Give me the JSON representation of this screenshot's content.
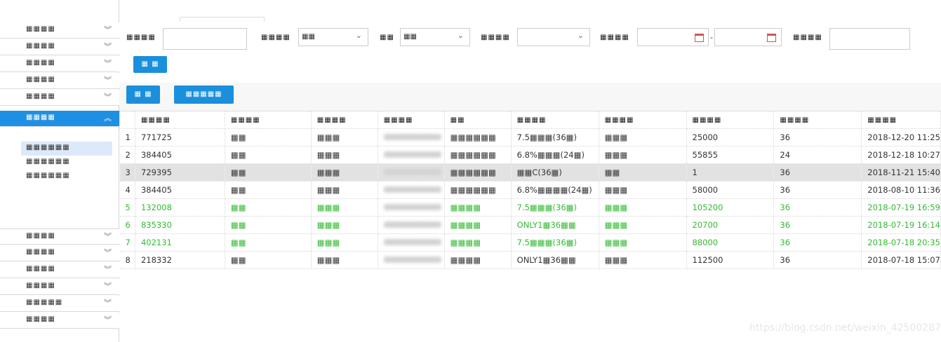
{
  "sidebar": {
    "top_items": [
      {
        "label": "▦▦▦▦"
      },
      {
        "label": "▦▦▦▦"
      },
      {
        "label": "▦▦▦▦"
      },
      {
        "label": "▦▦▦▦"
      },
      {
        "label": "▦▦▦▦"
      },
      {
        "label": "▦▦▦▦"
      }
    ],
    "sub_items": [
      {
        "label": "▦▦▦▦▦▦"
      },
      {
        "label": "▦▦▦▦▦▦"
      },
      {
        "label": "▦▦▦▦▦▦"
      }
    ],
    "bottom_items": [
      {
        "label": "▦▦▦▦"
      },
      {
        "label": "▦▦▦▦"
      },
      {
        "label": "▦▦▦▦"
      },
      {
        "label": "▦▦▦▦"
      },
      {
        "label": "▦▦▦▦▦"
      },
      {
        "label": "▦▦▦▦"
      }
    ]
  },
  "filters": {
    "f1_label": "▦▦▦▦",
    "f2_label": "▦▦▦▦",
    "f2_value": "▦▦",
    "f3_label": "▦▦",
    "f3_value": "▦▦",
    "f4_label": "▦▦▦▦",
    "f5_label": "▦▦▦▦",
    "date_sep": "-",
    "f6_label": "▦▦▦▦",
    "search_btn": "▦ ▦"
  },
  "toolbar": {
    "btn1": "▦ ▦",
    "btn2": "▦▦▦▦▦"
  },
  "table": {
    "headers": [
      "▦▦▦▦",
      "▦▦▦▦",
      "▦▦▦▦",
      "▦▦▦▦",
      "▦▦",
      "▦▦▦▦",
      "▦▦▦▦",
      "▦▦▦▦",
      "▦▦▦▦",
      "▦▦▦▦"
    ],
    "rows": [
      {
        "idx": "1",
        "c1": "771725",
        "c2": "▦▦",
        "c3": "▦▦▦",
        "c5": "▦▦▦▦▦▦",
        "c6": "7.5▦▦▦(36▦)",
        "c7": "▦▦▦",
        "c8": "25000",
        "c9": "36",
        "c10": "2018-12-20 11:25",
        "style": ""
      },
      {
        "idx": "2",
        "c1": "384405",
        "c2": "▦▦",
        "c3": "▦▦▦",
        "c5": "▦▦▦▦▦▦",
        "c6": "6.8%▦▦▦(24▦)",
        "c7": "▦▦▦",
        "c8": "55855",
        "c9": "24",
        "c10": "2018-12-18 10:27",
        "style": ""
      },
      {
        "idx": "3",
        "c1": "729395",
        "c2": "▦▦",
        "c3": "▦▦▦",
        "c5": "▦▦▦▦▦▦",
        "c6": "▦▦C(36▦)",
        "c7": "▦▦",
        "c8": "1",
        "c9": "36",
        "c10": "2018-11-21 15:40",
        "style": "gray"
      },
      {
        "idx": "4",
        "c1": "384405",
        "c2": "▦▦",
        "c3": "▦▦▦",
        "c5": "▦▦▦▦▦▦",
        "c6": "6.8%▦▦▦▦(24▦)",
        "c7": "▦▦▦",
        "c8": "58000",
        "c9": "36",
        "c10": "2018-08-10 11:36",
        "style": ""
      },
      {
        "idx": "5",
        "c1": "132008",
        "c2": "▦▦",
        "c3": "▦▦▦",
        "c5": "▦▦▦▦",
        "c6": "7.5▦▦▦(36▦)",
        "c7": "▦▦▦",
        "c8": "105200",
        "c9": "36",
        "c10": "2018-07-19 16:59",
        "style": "green"
      },
      {
        "idx": "6",
        "c1": "835330",
        "c2": "▦▦",
        "c3": "▦▦▦",
        "c5": "▦▦▦▦",
        "c6": "ONLY1▦36▦▦",
        "c7": "▦▦▦",
        "c8": "20700",
        "c9": "36",
        "c10": "2018-07-19 16:14",
        "style": "green"
      },
      {
        "idx": "7",
        "c1": "402131",
        "c2": "▦▦",
        "c3": "▦▦▦",
        "c5": "▦▦▦▦",
        "c6": "7.5▦▦▦(36▦)",
        "c7": "▦▦▦",
        "c8": "88000",
        "c9": "36",
        "c10": "2018-07-18 20:35",
        "style": "green"
      },
      {
        "idx": "8",
        "c1": "218332",
        "c2": "▦▦",
        "c3": "▦▦▦",
        "c5": "▦▦▦▦",
        "c6": "ONLY1▦36▦▦",
        "c7": "▦▦▦",
        "c8": "112500",
        "c9": "36",
        "c10": "2018-07-18 15:07",
        "style": ""
      }
    ]
  },
  "watermark": "https://blog.csdn.net/weixin_42500287",
  "colors": {
    "accent": "#1e90e3",
    "button": "#1a8fdc",
    "green_text": "#33bb33",
    "highlight_row": "#e2e2e2"
  }
}
